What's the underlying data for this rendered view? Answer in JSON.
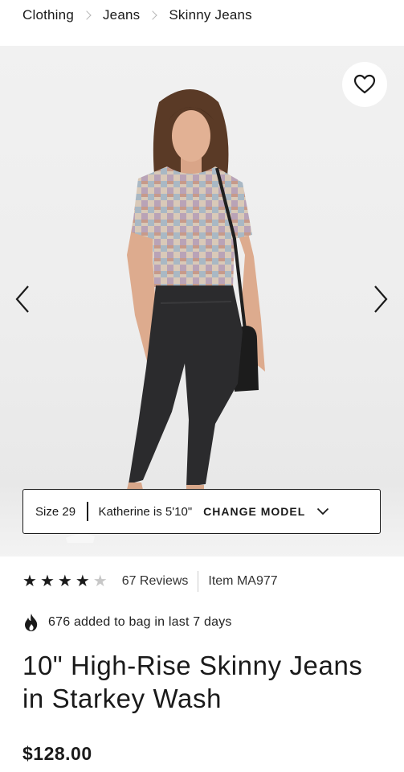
{
  "breadcrumb": {
    "items": [
      "Clothing",
      "Jeans",
      "Skinny Jeans"
    ]
  },
  "hero": {
    "favorite_icon": "heart-outline-icon",
    "prev_icon": "chevron-left-icon",
    "next_icon": "chevron-right-icon"
  },
  "model_bar": {
    "size": "Size 29",
    "model": "Katherine is 5'10\"",
    "change": "CHANGE MODEL",
    "chevron_icon": "chevron-down-icon"
  },
  "product": {
    "rating": 4,
    "rating_max": 5,
    "reviews": "67 Reviews",
    "item": "Item MA977",
    "popularity": "676 added to bag in last 7 days",
    "popularity_icon": "flame-icon",
    "title": "10\" High-Rise Skinny Jeans in Starkey Wash",
    "price": "$128.00"
  },
  "colors": {
    "text": "#1a1a1a",
    "star_off": "#c7c7c7",
    "background": "#ffffff"
  }
}
